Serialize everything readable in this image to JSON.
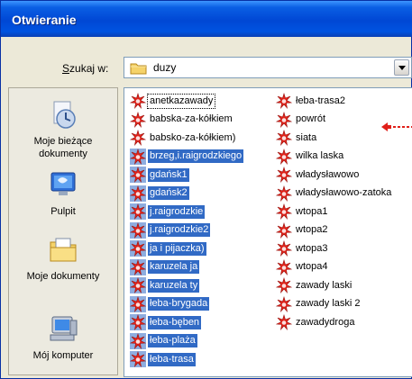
{
  "window": {
    "title": "Otwieranie"
  },
  "lookin": {
    "label_prefix": "",
    "label_underlined": "S",
    "label_rest": "zukaj w:",
    "value": "duzy"
  },
  "places": [
    {
      "label_line1": "Moje bieżące",
      "label_line2": "dokumenty",
      "icon": "recent-documents-icon"
    },
    {
      "label_line1": "Pulpit",
      "label_line2": "",
      "icon": "desktop-icon"
    },
    {
      "label_line1": "Moje dokumenty",
      "label_line2": "",
      "icon": "my-documents-icon"
    },
    {
      "label_line1": "Mój komputer",
      "label_line2": "",
      "icon": "my-computer-icon"
    }
  ],
  "files": {
    "icon": "application-file-icon",
    "column1": [
      {
        "name": "anetkazawady",
        "selected": false,
        "focused": true
      },
      {
        "name": "babska-za-kółkiem",
        "selected": false
      },
      {
        "name": "babsko-za-kółkiem)",
        "selected": false
      },
      {
        "name": "brzeg,i.raigrodzkiego",
        "selected": true
      },
      {
        "name": "gdańsk1",
        "selected": true
      },
      {
        "name": "gdańsk2",
        "selected": true
      },
      {
        "name": "j.raigrodzkie",
        "selected": true
      },
      {
        "name": "j.raigrodzkie2",
        "selected": true
      },
      {
        "name": "ja i pijaczka)",
        "selected": true
      },
      {
        "name": "karuzela ja",
        "selected": true
      },
      {
        "name": "karuzela ty",
        "selected": true
      },
      {
        "name": "łeba-brygada",
        "selected": true
      },
      {
        "name": "łeba-bęben",
        "selected": true
      },
      {
        "name": "łeba-plaża",
        "selected": true
      },
      {
        "name": "łeba-trasa",
        "selected": true
      }
    ],
    "column2": [
      {
        "name": "łeba-trasa2",
        "selected": false
      },
      {
        "name": "powrót",
        "selected": false
      },
      {
        "name": "siata",
        "selected": false
      },
      {
        "name": "wilka laska",
        "selected": false
      },
      {
        "name": "władysławowo",
        "selected": false
      },
      {
        "name": "władysławowo-zatoka",
        "selected": false
      },
      {
        "name": "wtopa1",
        "selected": false
      },
      {
        "name": "wtopa2",
        "selected": false
      },
      {
        "name": "wtopa3",
        "selected": false
      },
      {
        "name": "wtopa4",
        "selected": false
      },
      {
        "name": "zawady laski",
        "selected": false
      },
      {
        "name": "zawady laski 2",
        "selected": false
      },
      {
        "name": "zawadydroga",
        "selected": false
      }
    ]
  },
  "colors": {
    "selection": "#316ac5",
    "title_bar": "#0a5fe4",
    "annotation_arrow": "#e0201a"
  }
}
